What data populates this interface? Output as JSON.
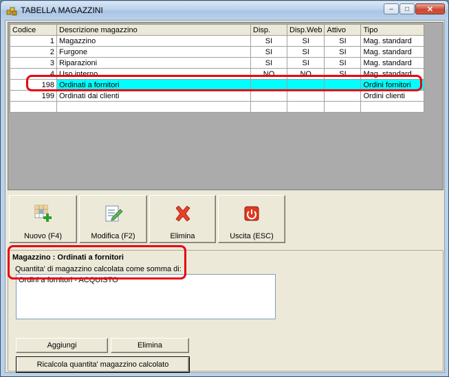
{
  "window": {
    "title": "TABELLA MAGAZZINI",
    "min_glyph": "–",
    "max_glyph": "□",
    "close_glyph": "✕"
  },
  "grid": {
    "columns": [
      "Codice",
      "Descrizione magazzino",
      "Disp.",
      "Disp.Web",
      "Attivo",
      "Tipo"
    ],
    "rows": [
      {
        "codice": "1",
        "descrizione": "Magazzino",
        "disp": "SI",
        "disp_web": "SI",
        "attivo": "SI",
        "tipo": "Mag. standard"
      },
      {
        "codice": "2",
        "descrizione": "Furgone",
        "disp": "SI",
        "disp_web": "SI",
        "attivo": "SI",
        "tipo": "Mag. standard"
      },
      {
        "codice": "3",
        "descrizione": "Riparazioni",
        "disp": "SI",
        "disp_web": "SI",
        "attivo": "SI",
        "tipo": "Mag. standard"
      },
      {
        "codice": "4",
        "descrizione": "Uso interno",
        "disp": "NO",
        "disp_web": "NO",
        "attivo": "SI",
        "tipo": "Mag. standard"
      },
      {
        "codice": "198",
        "descrizione": "Ordinati a fornitori",
        "disp": "",
        "disp_web": "",
        "attivo": "",
        "tipo": "Ordini fornitori"
      },
      {
        "codice": "199",
        "descrizione": "Ordinati dai clienti",
        "disp": "",
        "disp_web": "",
        "attivo": "",
        "tipo": "Ordini clienti"
      },
      {
        "codice": "",
        "descrizione": "",
        "disp": "",
        "disp_web": "",
        "attivo": "",
        "tipo": ""
      }
    ],
    "selected_codice": "198"
  },
  "toolbar": {
    "new_label": "Nuovo (F4)",
    "edit_label": "Modifica (F2)",
    "delete_label": "Elimina",
    "exit_label": "Uscita (ESC)"
  },
  "detail": {
    "title": "Magazzino : Ordinati a fornitori",
    "subtitle": "Quantita' di magazzino calcolata come somma di:",
    "items": [
      "Ordini a fornitori - ACQUISTO"
    ],
    "add_label": "Aggiungi",
    "delete_label": "Elimina",
    "recalc_label": "Ricalcola quantita' magazzino calcolato"
  },
  "colors": {
    "selection": "#00ffff",
    "highlight_box": "#e8000f"
  }
}
